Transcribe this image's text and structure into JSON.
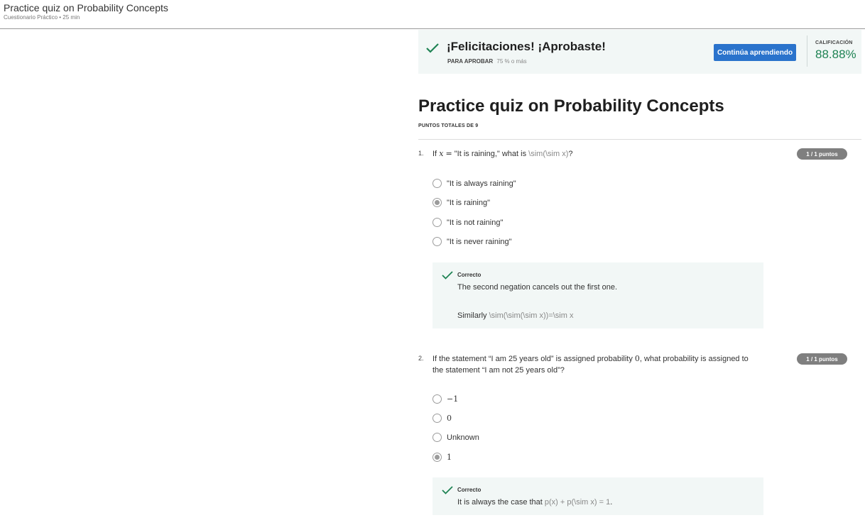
{
  "header": {
    "title": "Practice quiz on Probability Concepts",
    "subtitle": "Cuestionario Práctico • 25 min"
  },
  "banner": {
    "congrats": "¡Felicitaciones! ¡Aprobaste!",
    "to_pass_label": "PARA APROBAR",
    "to_pass_value": "75 % o más",
    "continue_label": "Continúa aprendiendo",
    "grade_label": "CALIFICACIÓN",
    "grade_value": "88.88%",
    "accent_color": "#1f8354",
    "button_color": "#2a73cc"
  },
  "quiz": {
    "title": "Practice quiz on Probability Concepts",
    "total_points": "PUNTOS TOTALES DE 9"
  },
  "questions": [
    {
      "number": "1.",
      "text_a": "If",
      "math_a": "x",
      "math_eq": "=",
      "text_b": "\"It is raining,\" what is",
      "text_c": "\\sim(\\sim x)",
      "text_d": "?",
      "points": "1 / 1 puntos",
      "options": [
        "\"It is always raining\"",
        "\"It is raining\"",
        "\"It is not raining\"",
        "\"It is never raining\""
      ],
      "selected_index": 1,
      "feedback_label": "Correcto",
      "feedback_line1": "The second negation cancels out the first one.",
      "feedback_line2_a": "Similarly",
      "feedback_line2_b": "\\sim(\\sim(\\sim x))=\\sim x"
    },
    {
      "number": "2.",
      "text_a": "If the statement “I am 25 years old” is assigned probability",
      "math_a": "0",
      "text_b": ", what probability is assigned to",
      "text_c": "the statement “I am not 25 years old”?",
      "points": "1 / 1 puntos",
      "options": [
        "−1",
        "0",
        "Unknown",
        "1"
      ],
      "selected_index": 3,
      "feedback_label": "Correcto",
      "feedback_line1_a": "It is always the case that",
      "feedback_line1_b": "p(x) + p(\\sim x) = 1",
      "feedback_line1_c": "."
    }
  ]
}
